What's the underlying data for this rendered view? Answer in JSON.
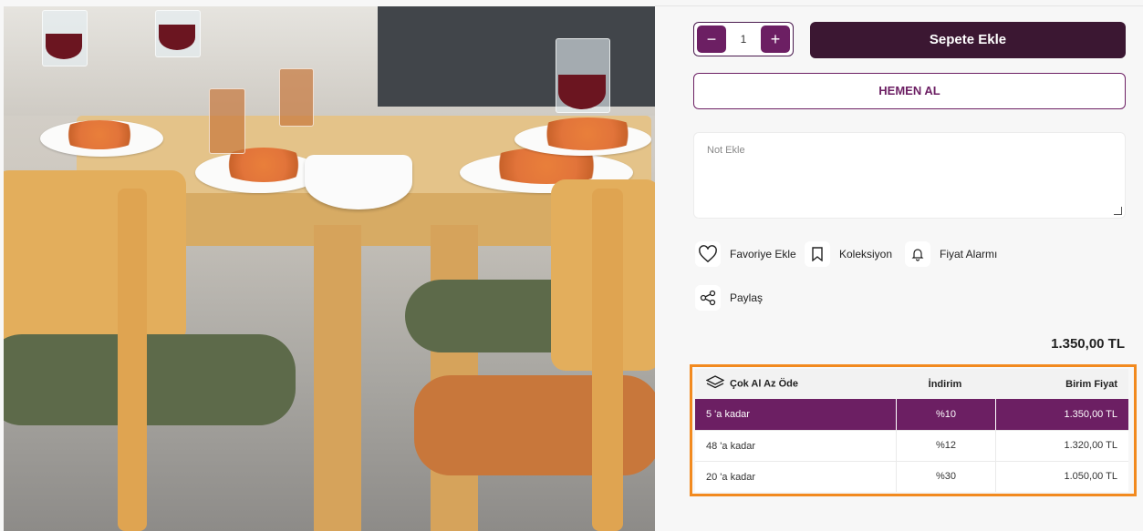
{
  "product": {
    "quantity": "1",
    "quantity_minus": "−",
    "quantity_plus": "+",
    "add_to_cart": "Sepete Ekle",
    "buy_now": "HEMEN AL",
    "note_placeholder": "Not Ekle",
    "price": "1.350,00 TL"
  },
  "actions": {
    "favorite": "Favoriye Ekle",
    "collection": "Koleksiyon",
    "price_alarm": "Fiyat Alarmı",
    "share": "Paylaş"
  },
  "bulk_table": {
    "headers": {
      "title": "Çok Al Az Öde",
      "discount": "İndirim",
      "unit_price": "Birim Fiyat"
    },
    "rows": [
      {
        "qty": "5 'a kadar",
        "discount": "%10",
        "price": "1.350,00 TL"
      },
      {
        "qty": "48 'a kadar",
        "discount": "%12",
        "price": "1.320,00 TL"
      },
      {
        "qty": "20 'a kadar",
        "discount": "%30",
        "price": "1.050,00 TL"
      }
    ],
    "selected_row": 0
  },
  "colors": {
    "accent": "#6c1f63",
    "dark_button": "#3b1732",
    "highlight_border": "#f28a1f"
  },
  "icons": [
    "minus-icon",
    "plus-icon",
    "heart-icon",
    "bookmark-icon",
    "bell-icon",
    "share-icon",
    "layers-icon",
    "resize-handle-icon"
  ]
}
